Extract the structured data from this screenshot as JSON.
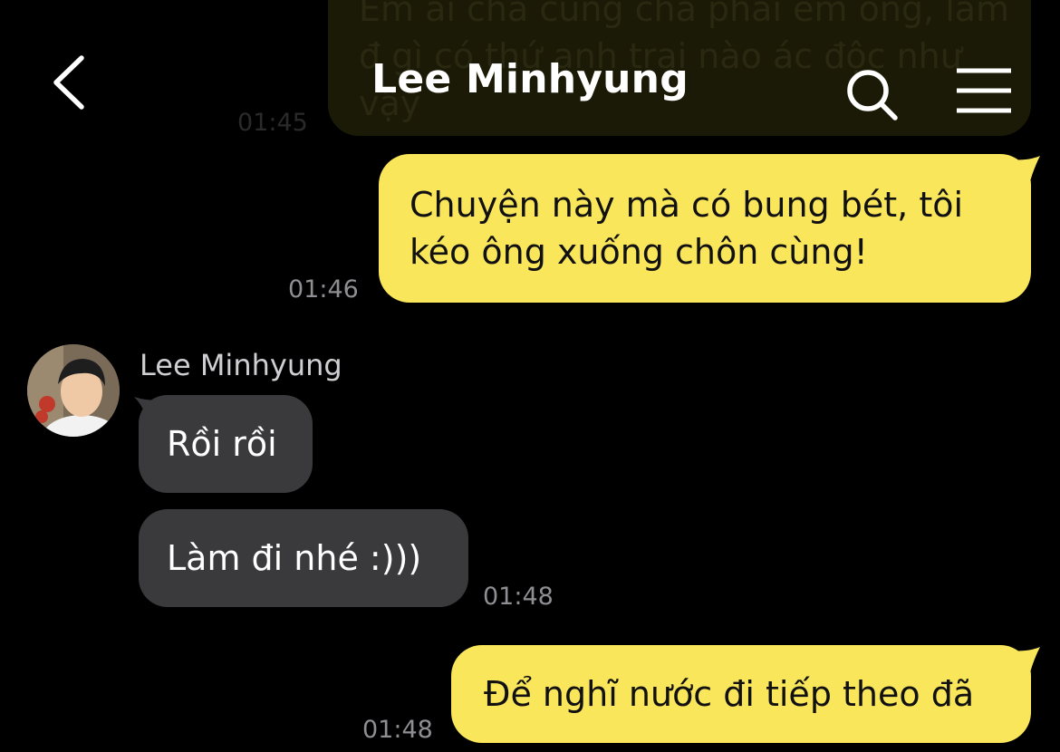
{
  "header": {
    "title": "Lee Minhyung"
  },
  "messages": {
    "m0": {
      "text": "Em ai chả cũng chả phải em ông, làm đ gì có thứ anh trai nào ác độc như vậy",
      "time": "01:45"
    },
    "m1": {
      "line1": "Chuyện này mà có bung bét, tôi",
      "line2": "kéo ông xuống chôn cùng!",
      "time": "01:46"
    },
    "sender_name": "Lee Minhyung",
    "m2": {
      "text": "Rồi rồi"
    },
    "m3": {
      "text": "Làm đi nhé :)))",
      "time": "01:48"
    },
    "m4": {
      "text": "Để nghĩ nước đi tiếp theo đã",
      "time": "01:48"
    }
  },
  "colors": {
    "background": "#000000",
    "outgoing_bubble": "#fae65b",
    "incoming_bubble": "#3a3a3c"
  }
}
